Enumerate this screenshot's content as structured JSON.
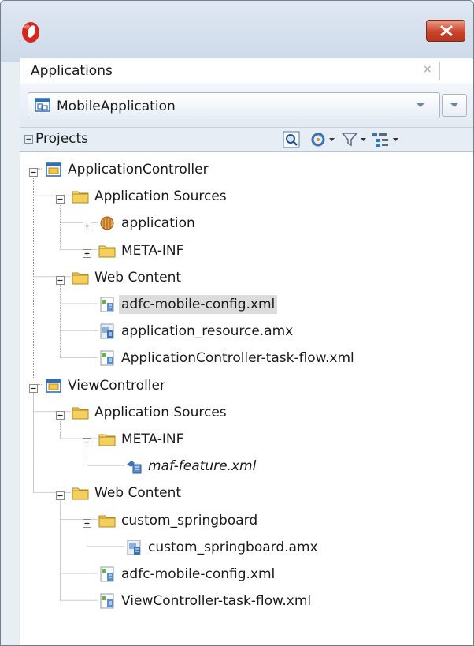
{
  "window": {
    "accent_close": "#c9452b",
    "frame": "#6f7f90"
  },
  "panel": {
    "tab_label": "Applications",
    "tab_close": "×"
  },
  "selector": {
    "application": "MobileApplication"
  },
  "projects": {
    "label": "Projects"
  },
  "tree": {
    "nodes": [
      {
        "label": "ApplicationController",
        "icon": "project-icon"
      },
      {
        "label": "Application Sources",
        "icon": "folder-icon"
      },
      {
        "label": "application",
        "icon": "package-icon"
      },
      {
        "label": "META-INF",
        "icon": "folder-icon"
      },
      {
        "label": "Web Content",
        "icon": "folder-icon"
      },
      {
        "label": "adfc-mobile-config.xml",
        "icon": "xml-file-icon",
        "selected": true
      },
      {
        "label": "application_resource.amx",
        "icon": "amx-file-icon"
      },
      {
        "label": "ApplicationController-task-flow.xml",
        "icon": "xml-file-icon"
      },
      {
        "label": "ViewController",
        "icon": "project-icon"
      },
      {
        "label": "Application Sources",
        "icon": "folder-icon"
      },
      {
        "label": "META-INF",
        "icon": "folder-icon"
      },
      {
        "label": "maf-feature.xml",
        "icon": "feature-file-icon",
        "italic": true
      },
      {
        "label": "Web Content",
        "icon": "folder-icon"
      },
      {
        "label": "custom_springboard",
        "icon": "folder-icon"
      },
      {
        "label": "custom_springboard.amx",
        "icon": "amx-file-icon"
      },
      {
        "label": "adfc-mobile-config.xml",
        "icon": "xml-file-icon"
      },
      {
        "label": "ViewController-task-flow.xml",
        "icon": "xml-file-icon"
      }
    ]
  }
}
